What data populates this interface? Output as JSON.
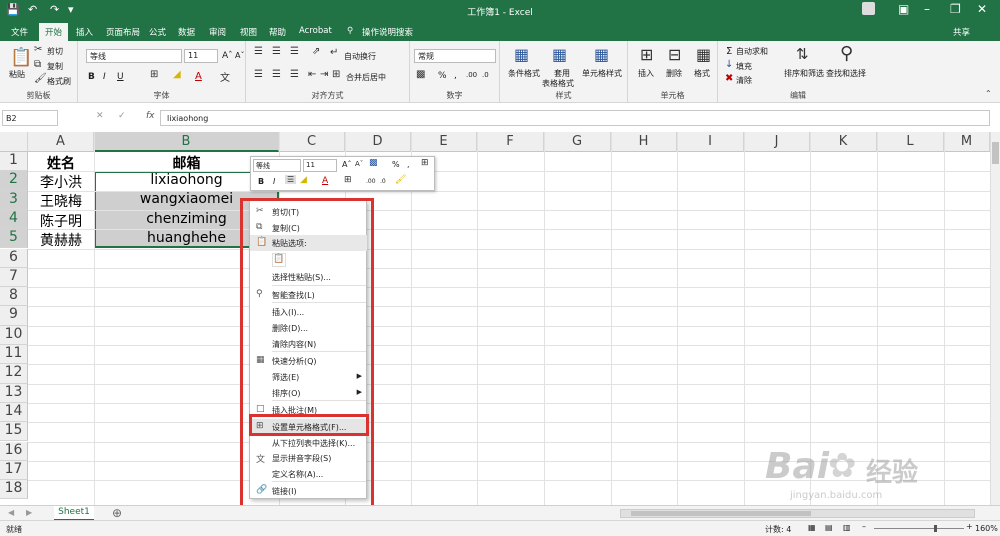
{
  "title": "工作簿1 - Excel",
  "tabs": [
    "文件",
    "开始",
    "插入",
    "页面布局",
    "公式",
    "数据",
    "审阅",
    "视图",
    "帮助",
    "Acrobat",
    "操作说明搜索"
  ],
  "share": "共享",
  "ribbon": {
    "clipboard": {
      "paste": "粘贴",
      "cut": "剪切",
      "copy": "复制",
      "painter": "格式刷",
      "label": "剪贴板"
    },
    "font": {
      "name": "等线",
      "size": "11",
      "label": "字体"
    },
    "align": {
      "wrap": "自动换行",
      "merge": "合并后居中",
      "label": "对齐方式"
    },
    "number": {
      "format": "常规",
      "label": "数字"
    },
    "styles": {
      "cond": "条件格式",
      "table1": "套用",
      "table2": "表格格式",
      "cellstyle": "单元格样式",
      "label": "样式"
    },
    "cells": {
      "insert": "插入",
      "delete": "删除",
      "format": "格式",
      "label": "单元格"
    },
    "editing": {
      "autosum": "自动求和",
      "fill": "填充",
      "clear": "清除",
      "sort": "排序和筛选",
      "find": "查找和选择",
      "label": "编辑"
    }
  },
  "formula": {
    "namebox": "B2",
    "content": "lixiaohong"
  },
  "columns": [
    "A",
    "B",
    "C",
    "D",
    "E",
    "F",
    "G",
    "H",
    "I",
    "J",
    "K",
    "L",
    "M"
  ],
  "rows": [
    "1",
    "2",
    "3",
    "4",
    "5",
    "6",
    "7",
    "8",
    "9",
    "10",
    "11",
    "12",
    "13",
    "14",
    "15",
    "16",
    "17",
    "18"
  ],
  "cells": {
    "a1": "姓名",
    "b1": "邮箱",
    "a2": "李小洪",
    "b2": "lixiaohong",
    "a3": "王晓梅",
    "b3": "wangxiaomei",
    "a4": "陈子明",
    "b4": "chenziming",
    "a5": "黄赫赫",
    "b5": "huanghehe"
  },
  "mini_toolbar": {
    "font": "等线",
    "size": "11"
  },
  "context_menu": {
    "cut": "剪切(T)",
    "copy": "复制(C)",
    "paste_options": "粘贴选项:",
    "paste_special": "选择性粘贴(S)...",
    "smart_lookup": "智能查找(L)",
    "insert": "插入(I)...",
    "delete": "删除(D)...",
    "clear": "清除内容(N)",
    "quick_analysis": "快速分析(Q)",
    "filter": "筛选(E)",
    "sort": "排序(O)",
    "comment": "插入批注(M)",
    "format_cells": "设置单元格格式(F)...",
    "dropdown": "从下拉列表中选择(K)...",
    "phonetic": "显示拼音字段(S)",
    "define_name": "定义名称(A)...",
    "link": "链接(I)"
  },
  "sheet": {
    "tab": "Sheet1"
  },
  "status": {
    "ready": "就绪",
    "count": "计数: 4",
    "zoom": "160%"
  },
  "watermark": {
    "brand": "Bai",
    "brand2": "经验",
    "url": "jingyan.baidu.com"
  },
  "colors": {
    "excel_green": "#217346",
    "highlight": "#d9322f"
  }
}
